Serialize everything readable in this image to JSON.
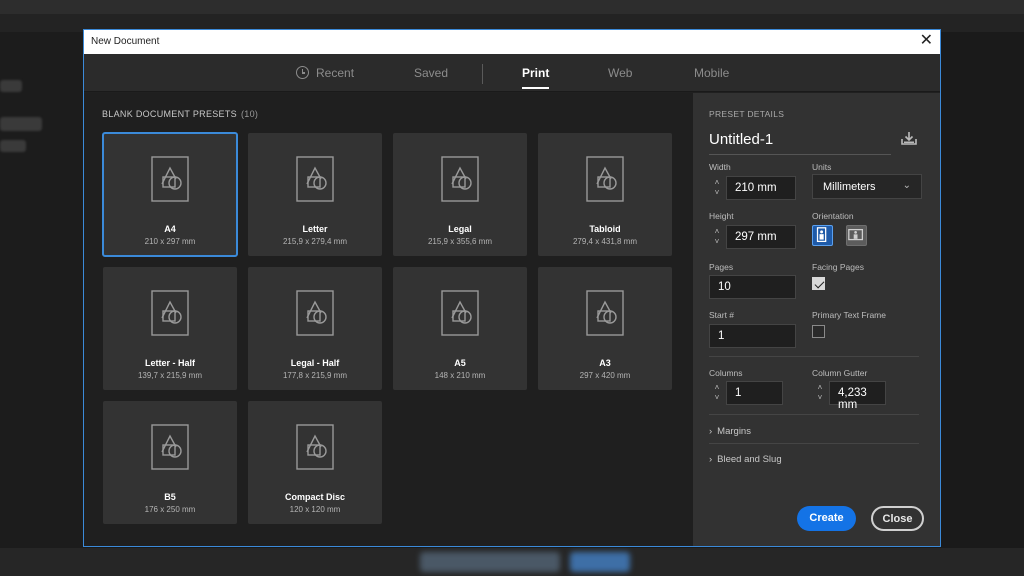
{
  "dialog": {
    "title": "New Document"
  },
  "tabs": [
    {
      "label": "Recent"
    },
    {
      "label": "Saved"
    },
    {
      "label": "Print"
    },
    {
      "label": "Web"
    },
    {
      "label": "Mobile"
    }
  ],
  "presets": {
    "header": "BLANK DOCUMENT PRESETS",
    "count": "(10)",
    "items": [
      {
        "name": "A4",
        "size": "210 x 297 mm"
      },
      {
        "name": "Letter",
        "size": "215,9 x 279,4 mm"
      },
      {
        "name": "Legal",
        "size": "215,9 x 355,6 mm"
      },
      {
        "name": "Tabloid",
        "size": "279,4 x 431,8 mm"
      },
      {
        "name": "Letter - Half",
        "size": "139,7 x 215,9 mm"
      },
      {
        "name": "Legal - Half",
        "size": "177,8 x 215,9 mm"
      },
      {
        "name": "A5",
        "size": "148 x 210 mm"
      },
      {
        "name": "A3",
        "size": "297 x 420 mm"
      },
      {
        "name": "B5",
        "size": "176 x 250 mm"
      },
      {
        "name": "Compact Disc",
        "size": "120 x 120 mm"
      }
    ]
  },
  "details": {
    "header": "PRESET DETAILS",
    "doc_name": "Untitled-1",
    "width_label": "Width",
    "width_value": "210 mm",
    "units_label": "Units",
    "units_value": "Millimeters",
    "height_label": "Height",
    "height_value": "297 mm",
    "orientation_label": "Orientation",
    "pages_label": "Pages",
    "pages_value": "10",
    "facing_label": "Facing Pages",
    "start_label": "Start #",
    "start_value": "1",
    "primary_label": "Primary Text Frame",
    "columns_label": "Columns",
    "columns_value": "1",
    "gutter_label": "Column Gutter",
    "gutter_value": "4,233 mm",
    "margins_label": "Margins",
    "bleed_label": "Bleed and Slug",
    "create_label": "Create",
    "close_label": "Close"
  },
  "colors": {
    "accent": "#1473e6",
    "selection": "#3b8ad9"
  },
  "icons": [
    "clock-icon",
    "document-preset-icon",
    "save-preset-icon",
    "portrait-icon",
    "landscape-icon",
    "close-icon",
    "chevron-down-icon",
    "chevron-right-icon"
  ]
}
